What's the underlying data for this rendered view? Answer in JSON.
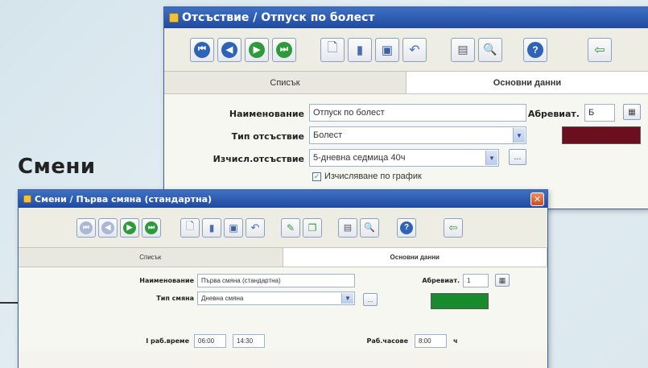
{
  "page": {
    "heading": "Смени"
  },
  "absence_window": {
    "title": "Отсъствие / Отпуск по болест",
    "tabs": [
      "Списък",
      "Основни данни"
    ],
    "form": {
      "name_label": "Наименование",
      "name_value": "Отпуск по болест",
      "abbr_label": "Абревиат.",
      "abbr_value": "Б",
      "type_label": "Тип отсъствие",
      "type_value": "Болест",
      "calc_label": "Изчисл.отсъствие",
      "calc_value": "5-дневна седмица 40ч",
      "checkbox_label": "Изчисляване по график",
      "color": "#6b0f1f"
    }
  },
  "shift_window": {
    "title": "Смени / Първа смяна (стандартна)",
    "tabs": [
      "Списък",
      "Основни данни"
    ],
    "form": {
      "name_label": "Наименование",
      "name_value": "Първа смяна (стандартна)",
      "abbr_label": "Абревиат.",
      "abbr_value": "1",
      "type_label": "Тип смяна",
      "type_value": "Дневна смяна",
      "work_time_label": "I раб.време",
      "work_time_from": "06:00",
      "work_time_to": "14:30",
      "work_hours_label": "Раб.часове",
      "work_hours_value": "8:00",
      "work_hours_unit": "ч",
      "color": "#1a8a2e"
    }
  },
  "colors": {
    "titlebar": "#2a56aa",
    "absence_swatch": "#6b0f1f",
    "shift_swatch": "#1a8a2e"
  }
}
